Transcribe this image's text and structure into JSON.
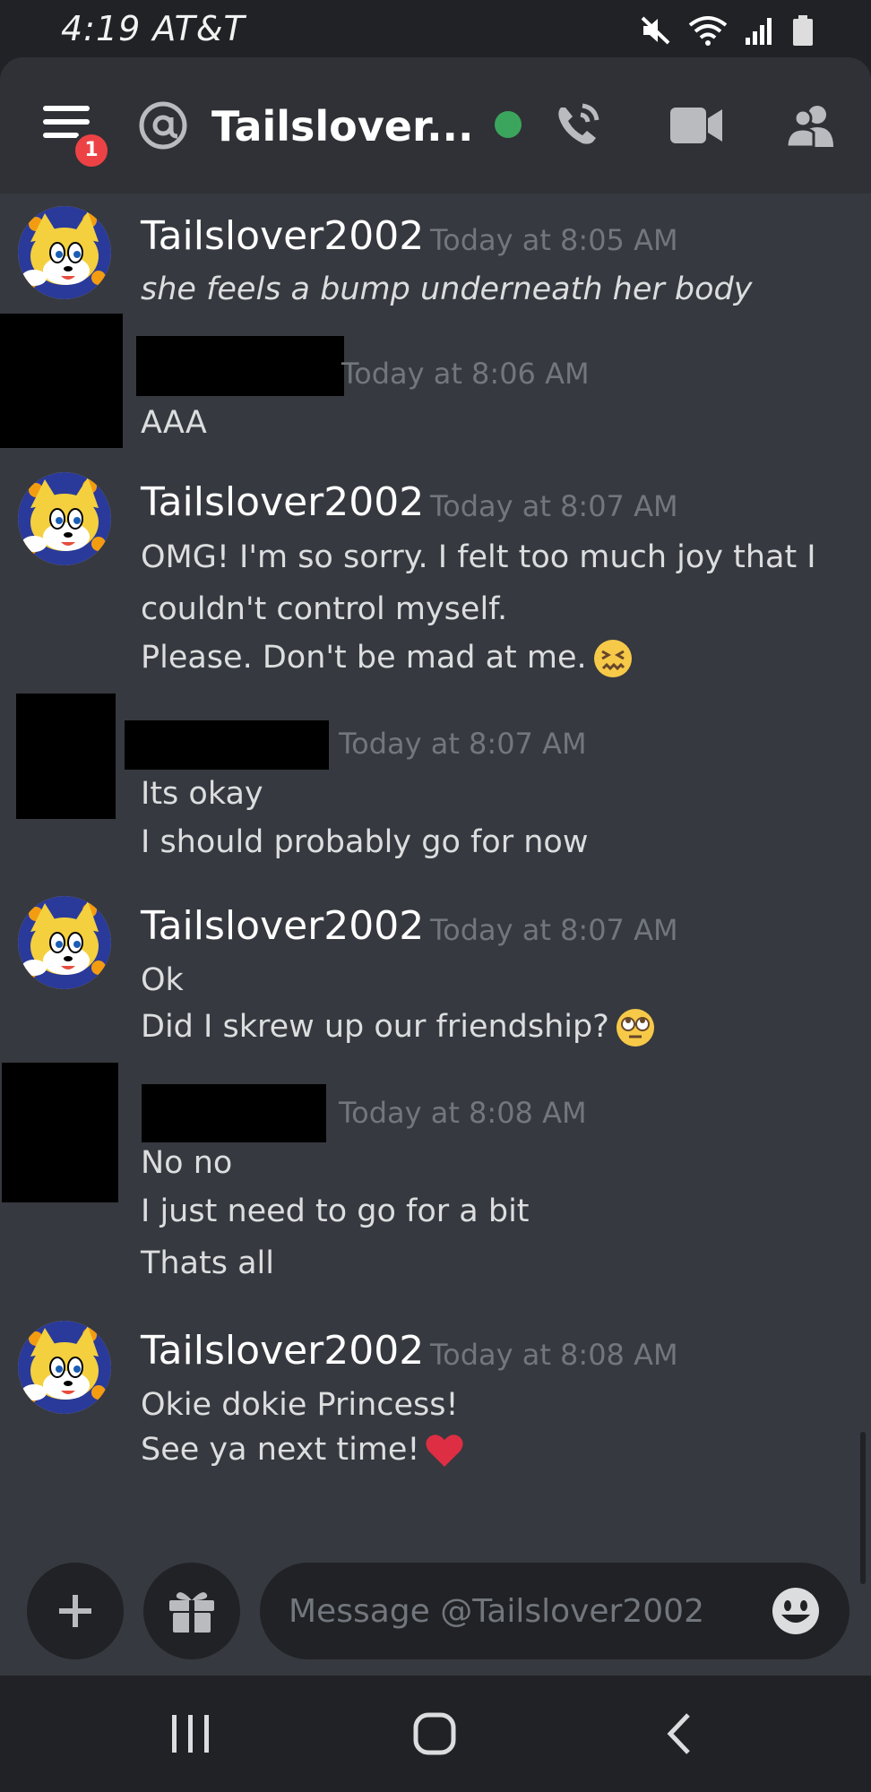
{
  "status_bar": {
    "time_carrier": "4:19 AT&T",
    "icons": [
      "mute-icon",
      "wifi-icon",
      "signal-icon",
      "battery-icon"
    ]
  },
  "header": {
    "notification_count": "1",
    "channel_name": "Tailslover...",
    "status": "online",
    "icons": [
      "menu-icon",
      "at-icon",
      "phone-call-icon",
      "video-call-icon",
      "members-icon"
    ]
  },
  "messages": [
    {
      "author": "Tailslover2002",
      "time": "Today at 8:05 AM",
      "lines": [
        "she feels a bump underneath her body"
      ],
      "italic": true
    },
    {
      "author": "",
      "time": "Today at 8:06 AM",
      "lines": [
        "AAA"
      ],
      "redacted": true
    },
    {
      "author": "Tailslover2002",
      "time": "Today at 8:07 AM",
      "lines": [
        "OMG! I'm so sorry. I felt too much joy that I",
        "couldn't control myself.",
        "Please. Don't be mad at me."
      ],
      "emoji": "confounded-face"
    },
    {
      "author": "",
      "time": "Today at 8:07 AM",
      "lines": [
        "Its okay",
        "I should probably go for now"
      ],
      "redacted": true
    },
    {
      "author": "Tailslover2002",
      "time": "Today at 8:07 AM",
      "lines": [
        "Ok",
        "Did I skrew up our friendship?"
      ],
      "emoji": "rolling-eyes-face"
    },
    {
      "author": "",
      "time": "Today at 8:08 AM",
      "lines": [
        "No no",
        "I just need to go for a bit",
        "Thats all"
      ],
      "redacted": true
    },
    {
      "author": "Tailslover2002",
      "time": "Today at 8:08 AM",
      "lines": [
        "Okie dokie Princess!",
        "See ya next time!"
      ],
      "emoji": "red-heart"
    }
  ],
  "composer": {
    "placeholder": "Message @Tailslover2002"
  },
  "colors": {
    "background": "#36393f",
    "header": "#2f3136",
    "dark": "#202225",
    "online": "#3ba55d",
    "badge": "#ed4245",
    "timestamp": "#72767d",
    "text": "#dcddde"
  }
}
